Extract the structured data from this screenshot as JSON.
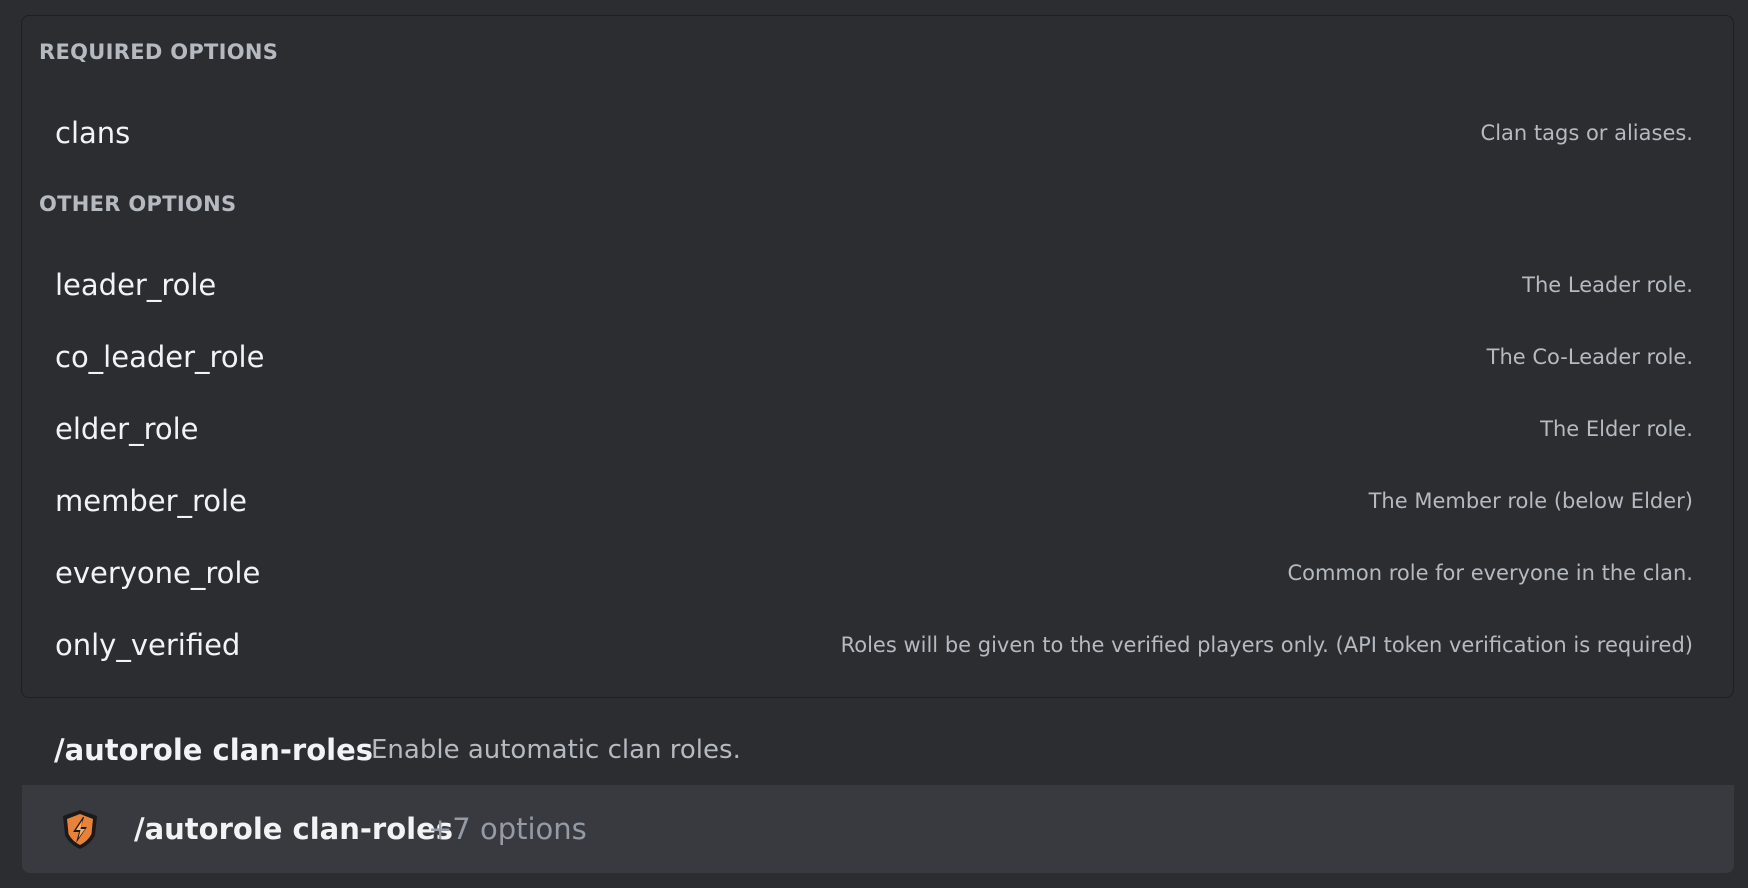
{
  "options_panel": {
    "required_header": "REQUIRED OPTIONS",
    "required": [
      {
        "name": "clans",
        "description": "Clan tags or aliases."
      }
    ],
    "other_header": "OTHER OPTIONS",
    "other": [
      {
        "name": "leader_role",
        "description": "The Leader role."
      },
      {
        "name": "co_leader_role",
        "description": "The Co-Leader role."
      },
      {
        "name": "elder_role",
        "description": "The Elder role."
      },
      {
        "name": "member_role",
        "description": "The Member role (below Elder)"
      },
      {
        "name": "everyone_role",
        "description": "Common role for everyone in the clan."
      },
      {
        "name": "only_verified",
        "description": "Roles will be given to the verified players only. (API token verification is required)"
      }
    ]
  },
  "command_preview": {
    "name": "/autorole clan-roles",
    "description": "Enable automatic clan roles."
  },
  "command_item": {
    "icon": "bot-avatar-icon",
    "name": "/autorole clan-roles",
    "options_count": "+7 options"
  },
  "colors": {
    "background": "#2b2d31",
    "selected_row": "#383a40",
    "icon_orange": "#e8823a",
    "icon_dark": "#1a1a1a"
  }
}
